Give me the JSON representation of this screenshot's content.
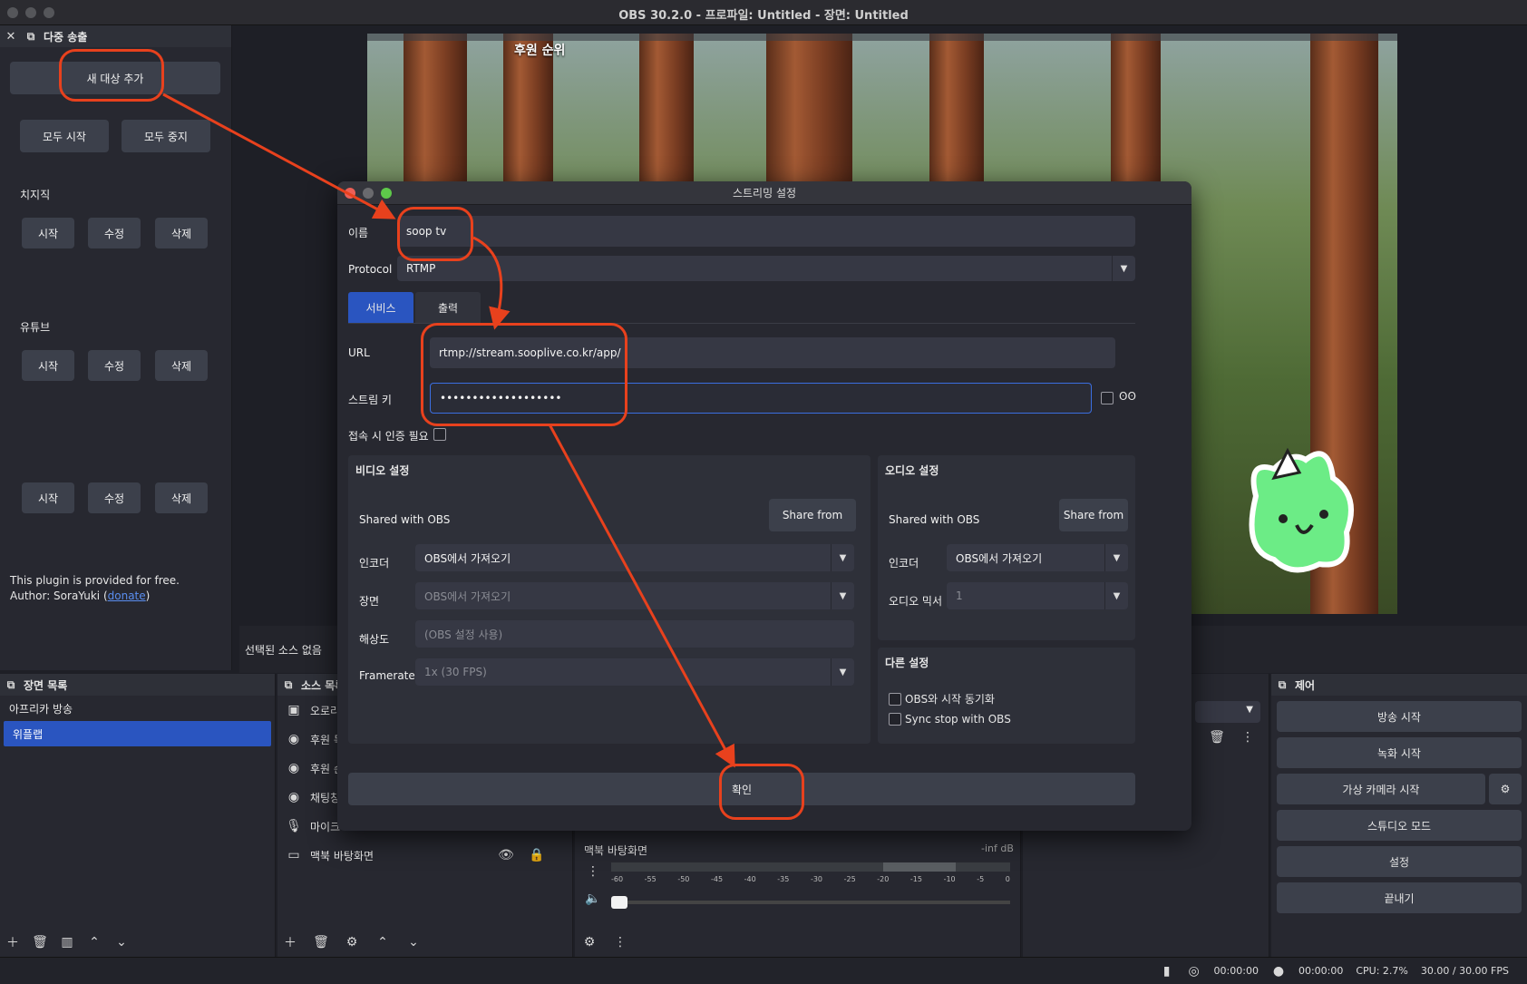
{
  "window": {
    "title": "OBS 30.2.0 - 프로파일: Untitled - 장면: Untitled"
  },
  "multi_dock": {
    "title": "다중 송출",
    "add_target": "새 대상 추가",
    "start_all": "모두 시작",
    "stop_all": "모두 중지",
    "targets": [
      {
        "name": "치지직",
        "start": "시작",
        "edit": "수정",
        "delete": "삭제"
      },
      {
        "name": "유튜브",
        "start": "시작",
        "edit": "수정",
        "delete": "삭제"
      },
      {
        "name": "",
        "start": "시작",
        "edit": "수정",
        "delete": "삭제"
      }
    ],
    "plugin_note": "This plugin is provided for free.",
    "author_prefix": "Author: SoraYuki (",
    "donate": "donate",
    "author_suffix": ")"
  },
  "preview": {
    "overlay_text": "후원 순위"
  },
  "no_source": "선택된 소스 없음",
  "scenes": {
    "title": "장면 목록",
    "items": [
      "아프리카 방송",
      "위플랩"
    ],
    "selected": 1
  },
  "sources": {
    "title": "소스 목록",
    "items": [
      {
        "icon": "image-icon",
        "label": "오로라"
      },
      {
        "icon": "globe-icon",
        "label": "후원 목록"
      },
      {
        "icon": "globe-icon",
        "label": "후원 순위"
      },
      {
        "icon": "globe-icon",
        "label": "채팅창"
      },
      {
        "icon": "mic-icon",
        "label": "마이크"
      },
      {
        "icon": "monitor-icon",
        "label": "맥북 바탕화면"
      }
    ]
  },
  "mixer": {
    "channel": "맥북 바탕화면",
    "level": "-inf dB",
    "ticks": [
      "-60",
      "-55",
      "-50",
      "-45",
      "-40",
      "-35",
      "-30",
      "-25",
      "-20",
      "-15",
      "-10",
      "-5",
      "0"
    ]
  },
  "controls": {
    "title": "제어",
    "buttons": [
      "방송 시작",
      "녹화 시작",
      "가상 카메라 시작",
      "스튜디오 모드",
      "설정",
      "끝내기"
    ]
  },
  "status": {
    "stream_time": "00:00:00",
    "rec_time": "00:00:00",
    "cpu": "CPU: 2.7%",
    "fps": "30.00 / 30.00 FPS"
  },
  "dialog": {
    "title": "스트리밍 설정",
    "name_label": "이름",
    "name_value": "soop tv",
    "protocol_label": "Protocol",
    "protocol_value": "RTMP",
    "tabs": [
      "서비스",
      "출력"
    ],
    "url_label": "URL",
    "url_value": "rtmp://stream.sooplive.co.kr/app/",
    "key_label": "스트림 키",
    "key_value": "•••••••••••••••••••",
    "auth_label": "접속 시 인증 필요",
    "video": {
      "title": "비디오 설정",
      "shared": "Shared with OBS",
      "share_btn": "Share from",
      "encoder_label": "인코더",
      "encoder_value": "OBS에서 가져오기",
      "scene_label": "장면",
      "scene_value": "OBS에서 가져오기",
      "res_label": "해상도",
      "res_placeholder": "(OBS 설정 사용)",
      "fr_label": "Framerate",
      "fr_value": "1x (30 FPS)"
    },
    "audio": {
      "title": "오디오 설정",
      "shared": "Shared with OBS",
      "share_btn": "Share from",
      "encoder_label": "인코더",
      "encoder_value": "OBS에서 가져오기",
      "mixer_label": "오디오 믹서",
      "mixer_value": "1"
    },
    "other": {
      "title": "다른 설정",
      "sync_start": "OBS와 시작 동기화",
      "sync_stop": "Sync stop with OBS"
    },
    "confirm": "확인"
  },
  "annotation_color": "#e8411d"
}
